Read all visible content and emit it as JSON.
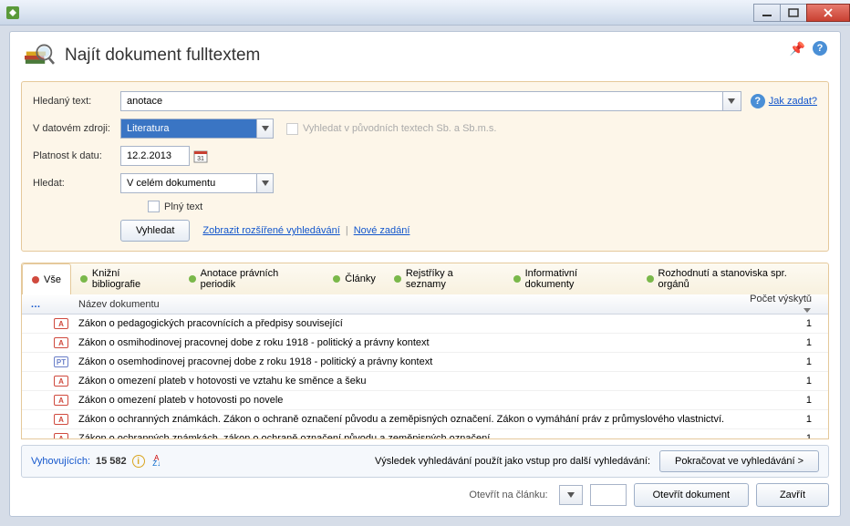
{
  "header": {
    "title": "Najít dokument fulltextem"
  },
  "form": {
    "label_text": "Hledaný text:",
    "text_value": "anotace",
    "help_link": "Jak zadat?",
    "label_source": "V datovém zdroji:",
    "source_value": "Literatura",
    "orig_check_label": "Vyhledat v původních textech Sb. a Sb.m.s.",
    "label_date": "Platnost k datu:",
    "date_value": "12.2.2013",
    "label_scope": "Hledat:",
    "scope_value": "V celém dokumentu",
    "fulltext_label": "Plný text",
    "search_btn": "Vyhledat",
    "advanced_link": "Zobrazit rozšířené vyhledávání",
    "new_link": "Nové zadání"
  },
  "tabs": [
    {
      "label": "Vše",
      "dot": "red"
    },
    {
      "label": "Knižní bibliografie",
      "dot": "green"
    },
    {
      "label": "Anotace právních periodik",
      "dot": "green"
    },
    {
      "label": "Články",
      "dot": "green"
    },
    {
      "label": "Rejstříky a seznamy",
      "dot": "green"
    },
    {
      "label": "Informativní dokumenty",
      "dot": "green"
    },
    {
      "label": "Rozhodnutí a stanoviska spr. orgánů",
      "dot": "green"
    }
  ],
  "grid": {
    "dots_header": "…",
    "col_name": "Název dokumentu",
    "col_count": "Počet výskytů",
    "rows": [
      {
        "badge": "A",
        "cls": "a",
        "name": "Zákon o pedagogických pracovnících a předpisy související",
        "count": "1"
      },
      {
        "badge": "A",
        "cls": "a",
        "name": "Zákon o osmihodinovej pracovnej dobe z roku 1918 - politický a právny kontext",
        "count": "1"
      },
      {
        "badge": "PT",
        "cls": "pt",
        "name": "Zákon o osemhodinovej pracovnej dobe z roku 1918 - politický a právny kontext",
        "count": "1"
      },
      {
        "badge": "A",
        "cls": "a",
        "name": "Zákon o omezení plateb v hotovosti ve vztahu ke směnce a šeku",
        "count": "1"
      },
      {
        "badge": "A",
        "cls": "a",
        "name": "Zákon o omezení plateb v hotovosti po novele",
        "count": "1"
      },
      {
        "badge": "A",
        "cls": "a",
        "name": "Zákon o ochranných známkách. Zákon o ochraně označení původu a zeměpisných označení. Zákon o vymáhání práv z průmyslového vlastnictví.",
        "count": "1"
      },
      {
        "badge": "A",
        "cls": "a",
        "name": "Zákon o ochranných známkách, zákon o ochraně označení původu a zeměpisných označení",
        "count": "1"
      }
    ]
  },
  "status": {
    "matching_label": "Vyhovujících:",
    "matching_value": "15 582",
    "result_text": "Výsledek vyhledávání použít jako vstup pro další vyhledávání:",
    "continue_btn": "Pokračovat ve vyhledávání >"
  },
  "footer": {
    "open_on_label": "Otevřít na článku:",
    "open_doc_btn": "Otevřít dokument",
    "close_btn": "Zavřít"
  }
}
